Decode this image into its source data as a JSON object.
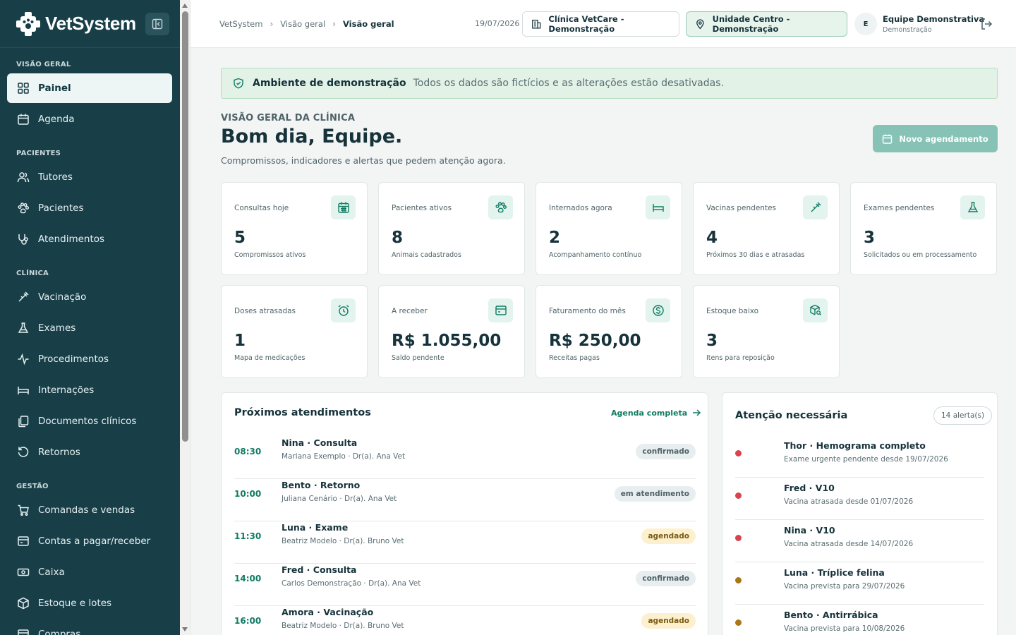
{
  "app": {
    "name": "VetSystem"
  },
  "sidebar": {
    "sections": [
      {
        "title": "VISÃO GERAL",
        "items": [
          {
            "label": "Painel",
            "icon": "dashboard-icon",
            "active": true
          },
          {
            "label": "Agenda",
            "icon": "calendar-icon"
          }
        ]
      },
      {
        "title": "PACIENTES",
        "items": [
          {
            "label": "Tutores",
            "icon": "users-icon"
          },
          {
            "label": "Pacientes",
            "icon": "paw-icon"
          },
          {
            "label": "Atendimentos",
            "icon": "stethoscope-icon"
          }
        ]
      },
      {
        "title": "CLÍNICA",
        "items": [
          {
            "label": "Vacinação",
            "icon": "syringe-icon"
          },
          {
            "label": "Exames",
            "icon": "flask-icon"
          },
          {
            "label": "Procedimentos",
            "icon": "activity-icon"
          },
          {
            "label": "Internações",
            "icon": "bed-icon"
          },
          {
            "label": "Documentos clínicos",
            "icon": "documents-icon"
          },
          {
            "label": "Retornos",
            "icon": "return-icon"
          }
        ]
      },
      {
        "title": "GESTÃO",
        "items": [
          {
            "label": "Comandas e vendas",
            "icon": "cart-icon"
          },
          {
            "label": "Contas a pagar/receber",
            "icon": "wallet-icon"
          },
          {
            "label": "Caixa",
            "icon": "cash-icon"
          },
          {
            "label": "Estoque e lotes",
            "icon": "package-icon"
          },
          {
            "label": "Compras",
            "icon": "purchase-icon"
          }
        ]
      }
    ]
  },
  "topbar": {
    "breadcrumbs": [
      "VetSystem",
      "Visão geral",
      "Visão geral"
    ],
    "date": "19/07/2026",
    "clinic": "Clínica VetCare - Demonstração",
    "unit": "Unidade Centro - Demonstração",
    "user": {
      "initial": "E",
      "name": "Equipe Demonstrativa",
      "role": "Demonstração"
    }
  },
  "banner": {
    "title": "Ambiente de demonstração",
    "text": "Todos os dados são fictícios e as alterações estão desativadas."
  },
  "header": {
    "eyebrow": "VISÃO GERAL DA CLÍNICA",
    "greeting": "Bom dia, Equipe.",
    "subtitle": "Compromissos, indicadores e alertas que pedem atenção agora.",
    "new_button": "Novo agendamento"
  },
  "stats": [
    {
      "label": "Consultas hoje",
      "value": "5",
      "sub": "Compromissos ativos",
      "icon": "calendar-icon"
    },
    {
      "label": "Pacientes ativos",
      "value": "8",
      "sub": "Animais cadastrados",
      "icon": "paw-icon"
    },
    {
      "label": "Internados agora",
      "value": "2",
      "sub": "Acompanhamento contínuo",
      "icon": "bed-icon"
    },
    {
      "label": "Vacinas pendentes",
      "value": "4",
      "sub": "Próximos 30 dias e atrasadas",
      "icon": "syringe-icon"
    },
    {
      "label": "Exames pendentes",
      "value": "3",
      "sub": "Solicitados ou em processamento",
      "icon": "flask-icon"
    },
    {
      "label": "Doses atrasadas",
      "value": "1",
      "sub": "Mapa de medicações",
      "icon": "alarm-icon"
    },
    {
      "label": "A receber",
      "value": "R$ 1.055,00",
      "sub": "Saldo pendente",
      "icon": "wallet-icon"
    },
    {
      "label": "Faturamento do mês",
      "value": "R$ 250,00",
      "sub": "Receitas pagas",
      "icon": "dollar-icon"
    },
    {
      "label": "Estoque baixo",
      "value": "3",
      "sub": "Itens para reposição",
      "icon": "package-search-icon"
    }
  ],
  "appointments": {
    "title": "Próximos atendimentos",
    "link": "Agenda completa",
    "items": [
      {
        "time": "08:30",
        "title": "Nina · Consulta",
        "sub": "Mariana Exemplo · Dr(a). Ana Vet",
        "status": "confirmado",
        "kind": "conf"
      },
      {
        "time": "10:00",
        "title": "Bento · Retorno",
        "sub": "Juliana Cenário · Dr(a). Ana Vet",
        "status": "em atendimento",
        "kind": "atend"
      },
      {
        "time": "11:30",
        "title": "Luna · Exame",
        "sub": "Beatriz Modelo · Dr(a). Bruno Vet",
        "status": "agendado",
        "kind": "agen"
      },
      {
        "time": "14:00",
        "title": "Fred · Consulta",
        "sub": "Carlos Demonstração · Dr(a). Ana Vet",
        "status": "confirmado",
        "kind": "conf"
      },
      {
        "time": "16:00",
        "title": "Amora · Vacinação",
        "sub": "Beatriz Modelo · Dr(a). Bruno Vet",
        "status": "agendado",
        "kind": "agen"
      }
    ]
  },
  "alerts": {
    "title": "Atenção necessária",
    "count": "14 alerta(s)",
    "items": [
      {
        "title": "Thor · Hemograma completo",
        "sub": "Exame urgente pendente desde 19/07/2026",
        "color": "#d9434f"
      },
      {
        "title": "Fred · V10",
        "sub": "Vacina atrasada desde 01/07/2026",
        "color": "#d9434f"
      },
      {
        "title": "Nina · V10",
        "sub": "Vacina atrasada desde 14/07/2026",
        "color": "#d9434f"
      },
      {
        "title": "Luna · Tríplice felina",
        "sub": "Vacina prevista para 29/07/2026",
        "color": "#a8781a"
      },
      {
        "title": "Bento · Antirrábica",
        "sub": "Vacina prevista para 10/08/2026",
        "color": "#a8781a"
      }
    ]
  },
  "colors": {
    "sidebar": "#183f48",
    "accent": "#0f7c62",
    "primary_button": "#86c3b6",
    "banner": "#e2f2e7"
  }
}
